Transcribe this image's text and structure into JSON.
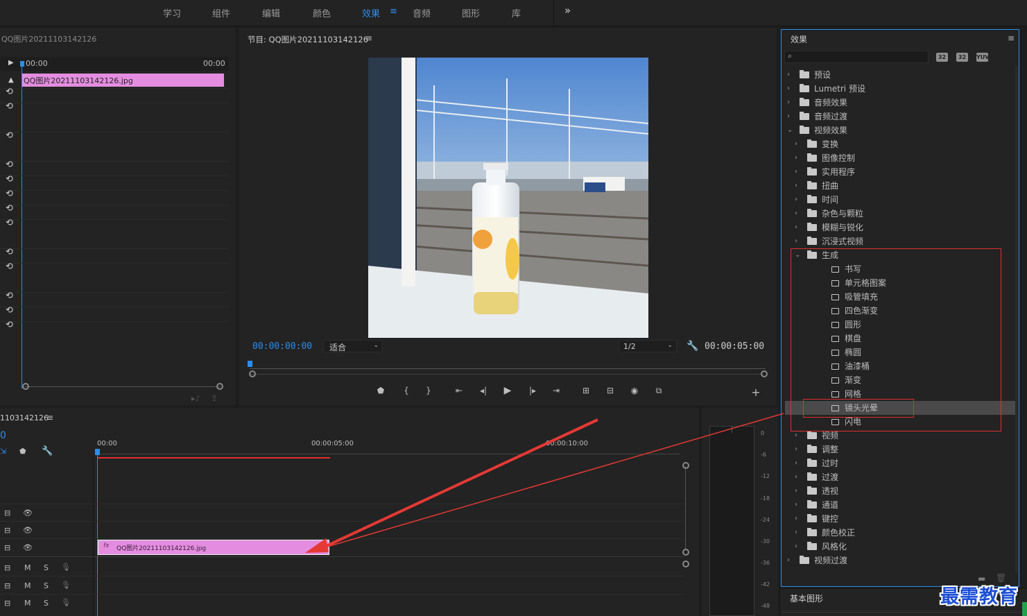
{
  "workspace_tabs": [
    {
      "label": "学习"
    },
    {
      "label": "组件"
    },
    {
      "label": "编辑"
    },
    {
      "label": "颜色"
    },
    {
      "label": "效果"
    },
    {
      "label": "音频"
    },
    {
      "label": "图形"
    },
    {
      "label": "库"
    }
  ],
  "workspace_more": "»",
  "workspace_menu_icon": "≡",
  "source": {
    "title": "QQ图片20211103142126",
    "time_start": "00:00",
    "time_end": "00:00",
    "clip_label": "QQ图片20211103142126.jpg",
    "clip_color": "#e48de0"
  },
  "program": {
    "title": "节目: QQ图片20211103142126",
    "menu_icon": "≡",
    "timecode_current": "00:00:00:00",
    "fit_label": "适合",
    "resolution": "1/2",
    "timecode_duration": "00:00:05:00"
  },
  "timeline": {
    "title": "1103142126",
    "menu_icon": "≡",
    "timecode": "0",
    "ruler": [
      "00:00",
      "00:00:05:00",
      "00:00:10:00"
    ],
    "clip_label": "QQ图片20211103142126.jpg",
    "clip_fx": "fx",
    "track_m": "M",
    "track_s": "S"
  },
  "meter": {
    "labels": [
      "0",
      "-6",
      "-12",
      "-18",
      "-24",
      "-30",
      "-36",
      "-42",
      "-48"
    ]
  },
  "effects": {
    "title": "效果",
    "menu_icon": "≡",
    "search_placeholder": "",
    "buttons": [
      "32",
      "32",
      "YUV"
    ],
    "tree": [
      {
        "label": "预设",
        "depth": 0,
        "expanded": false,
        "icon": "folder"
      },
      {
        "label": "Lumetri 预设",
        "depth": 0,
        "expanded": false,
        "icon": "folder"
      },
      {
        "label": "音频效果",
        "depth": 0,
        "expanded": false,
        "icon": "folder"
      },
      {
        "label": "音频过渡",
        "depth": 0,
        "expanded": false,
        "icon": "folder"
      },
      {
        "label": "视频效果",
        "depth": 0,
        "expanded": true,
        "icon": "folder"
      },
      {
        "label": "变换",
        "depth": 1,
        "expanded": false,
        "icon": "folder"
      },
      {
        "label": "图像控制",
        "depth": 1,
        "expanded": false,
        "icon": "folder"
      },
      {
        "label": "实用程序",
        "depth": 1,
        "expanded": false,
        "icon": "folder"
      },
      {
        "label": "扭曲",
        "depth": 1,
        "expanded": false,
        "icon": "folder"
      },
      {
        "label": "时间",
        "depth": 1,
        "expanded": false,
        "icon": "folder"
      },
      {
        "label": "杂色与颗粒",
        "depth": 1,
        "expanded": false,
        "icon": "folder"
      },
      {
        "label": "模糊与锐化",
        "depth": 1,
        "expanded": false,
        "icon": "folder"
      },
      {
        "label": "沉浸式视频",
        "depth": 1,
        "expanded": false,
        "icon": "folder"
      },
      {
        "label": "生成",
        "depth": 1,
        "expanded": true,
        "icon": "folder"
      },
      {
        "label": "书写",
        "depth": 2,
        "icon": "fx"
      },
      {
        "label": "单元格图案",
        "depth": 2,
        "icon": "fx"
      },
      {
        "label": "吸管填充",
        "depth": 2,
        "icon": "fx"
      },
      {
        "label": "四色渐变",
        "depth": 2,
        "icon": "fx"
      },
      {
        "label": "圆形",
        "depth": 2,
        "icon": "fx"
      },
      {
        "label": "棋盘",
        "depth": 2,
        "icon": "fx"
      },
      {
        "label": "椭圆",
        "depth": 2,
        "icon": "fx"
      },
      {
        "label": "油漆桶",
        "depth": 2,
        "icon": "fx"
      },
      {
        "label": "渐变",
        "depth": 2,
        "icon": "fx"
      },
      {
        "label": "网格",
        "depth": 2,
        "icon": "fx"
      },
      {
        "label": "镜头光晕",
        "depth": 2,
        "icon": "fx",
        "selected": true
      },
      {
        "label": "闪电",
        "depth": 2,
        "icon": "fx"
      },
      {
        "label": "视频",
        "depth": 1,
        "expanded": false,
        "icon": "folder"
      },
      {
        "label": "调整",
        "depth": 1,
        "expanded": false,
        "icon": "folder"
      },
      {
        "label": "过时",
        "depth": 1,
        "expanded": false,
        "icon": "folder"
      },
      {
        "label": "过渡",
        "depth": 1,
        "expanded": false,
        "icon": "folder"
      },
      {
        "label": "透视",
        "depth": 1,
        "expanded": false,
        "icon": "folder"
      },
      {
        "label": "通道",
        "depth": 1,
        "expanded": false,
        "icon": "folder"
      },
      {
        "label": "键控",
        "depth": 1,
        "expanded": false,
        "icon": "folder"
      },
      {
        "label": "颜色校正",
        "depth": 1,
        "expanded": false,
        "icon": "folder"
      },
      {
        "label": "风格化",
        "depth": 1,
        "expanded": false,
        "icon": "folder"
      },
      {
        "label": "视频过渡",
        "depth": 0,
        "expanded": false,
        "icon": "folder"
      }
    ]
  },
  "basic_graphics": {
    "title": "基本图形"
  },
  "watermark": "最需教育",
  "colors": {
    "accent": "#2d8ceb",
    "highlight_box": "#e03030",
    "arrow": "#e53935",
    "clip": "#e48de0",
    "playhead": "#2d8ceb"
  }
}
